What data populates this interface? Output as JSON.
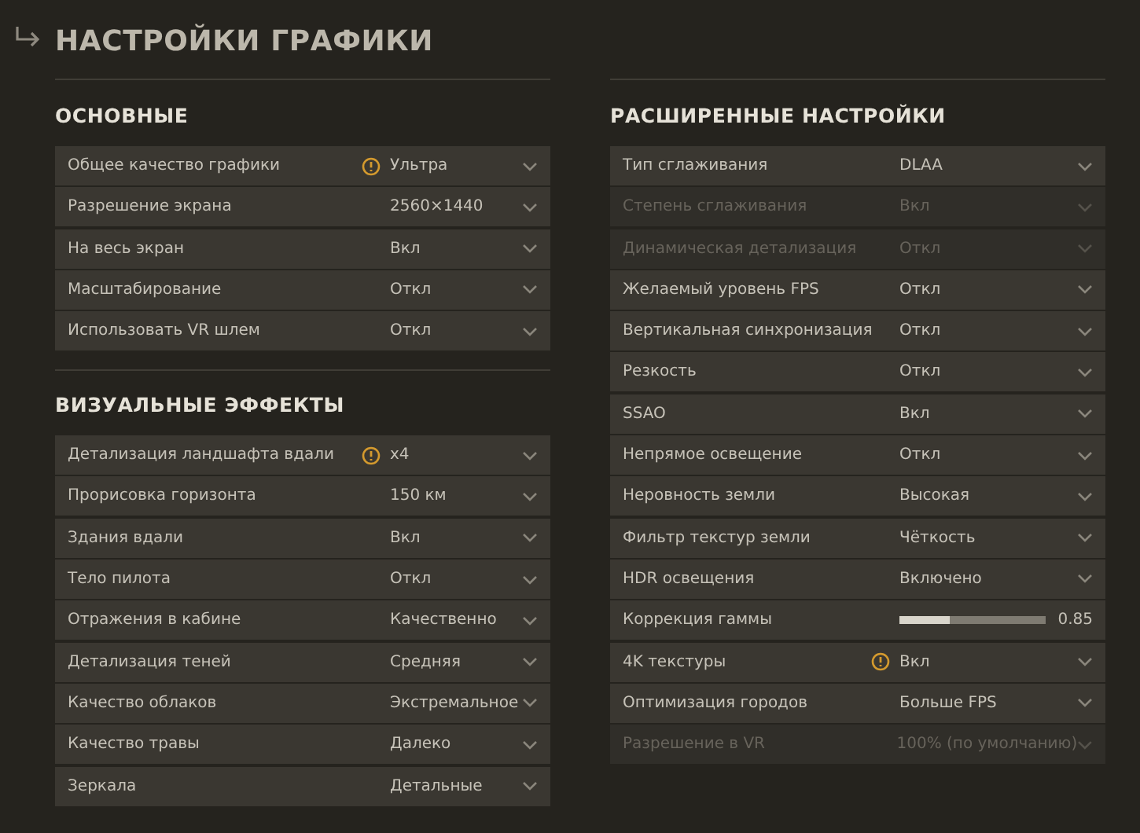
{
  "title": "НАСТРОЙКИ ГРАФИКИ",
  "columns": [
    {
      "sections": [
        {
          "heading": "ОСНОВНЫЕ",
          "rows": [
            {
              "kind": "select",
              "label": "Общее качество графики",
              "value": "Ультра",
              "warning": true,
              "disabled": false
            },
            {
              "kind": "select",
              "label": "Разрешение экрана",
              "value": "2560×1440",
              "warning": false,
              "disabled": false
            },
            {
              "kind": "select",
              "label": "На весь экран",
              "value": "Вкл",
              "warning": false,
              "disabled": false
            },
            {
              "kind": "select",
              "label": "Масштабирование",
              "value": "Откл",
              "warning": false,
              "disabled": false
            },
            {
              "kind": "select",
              "label": "Использовать VR шлем",
              "value": "Откл",
              "warning": false,
              "disabled": false
            }
          ]
        },
        {
          "heading": "ВИЗУАЛЬНЫЕ ЭФФЕКТЫ",
          "rows": [
            {
              "kind": "select",
              "label": "Детализация ландшафта вдали",
              "value": "x4",
              "warning": true,
              "disabled": false
            },
            {
              "kind": "select",
              "label": "Прорисовка горизонта",
              "value": "150 км",
              "warning": false,
              "disabled": false
            },
            {
              "kind": "select",
              "label": "Здания вдали",
              "value": "Вкл",
              "warning": false,
              "disabled": false
            },
            {
              "kind": "select",
              "label": "Тело пилота",
              "value": "Откл",
              "warning": false,
              "disabled": false
            },
            {
              "kind": "select",
              "label": "Отражения в кабине",
              "value": "Качественно",
              "warning": false,
              "disabled": false
            },
            {
              "kind": "select",
              "label": "Детализация теней",
              "value": "Средняя",
              "warning": false,
              "disabled": false
            },
            {
              "kind": "select",
              "label": "Качество облаков",
              "value": "Экстремальное",
              "warning": false,
              "disabled": false
            },
            {
              "kind": "select",
              "label": "Качество травы",
              "value": "Далеко",
              "warning": false,
              "disabled": false
            },
            {
              "kind": "select",
              "label": "Зеркала",
              "value": "Детальные",
              "warning": false,
              "disabled": false
            }
          ]
        }
      ]
    },
    {
      "sections": [
        {
          "heading": "РАСШИРЕННЫЕ НАСТРОЙКИ",
          "rows": [
            {
              "kind": "select",
              "label": "Тип сглаживания",
              "value": "DLAA",
              "warning": false,
              "disabled": false
            },
            {
              "kind": "select",
              "label": "Степень сглаживания",
              "value": "Вкл",
              "warning": false,
              "disabled": true
            },
            {
              "kind": "select",
              "label": "Динамическая детализация",
              "value": "Откл",
              "warning": false,
              "disabled": true
            },
            {
              "kind": "select",
              "label": "Желаемый уровень FPS",
              "value": "Откл",
              "warning": false,
              "disabled": false
            },
            {
              "kind": "select",
              "label": "Вертикальная синхронизация",
              "value": "Откл",
              "warning": false,
              "disabled": false
            },
            {
              "kind": "select",
              "label": "Резкость",
              "value": "Откл",
              "warning": false,
              "disabled": false
            },
            {
              "kind": "select",
              "label": "SSAO",
              "value": "Вкл",
              "warning": false,
              "disabled": false
            },
            {
              "kind": "select",
              "label": "Непрямое освещение",
              "value": "Откл",
              "warning": false,
              "disabled": false
            },
            {
              "kind": "select",
              "label": "Неровность земли",
              "value": "Высокая",
              "warning": false,
              "disabled": false
            },
            {
              "kind": "select",
              "label": "Фильтр текстур земли",
              "value": "Чёткость",
              "warning": false,
              "disabled": false
            },
            {
              "kind": "select",
              "label": "HDR освещения",
              "value": "Включено",
              "warning": false,
              "disabled": false
            },
            {
              "kind": "slider",
              "label": "Коррекция гаммы",
              "value": "0.85",
              "level": 0.35,
              "warning": false,
              "disabled": false
            },
            {
              "kind": "select",
              "label": "4K текстуры",
              "value": "Вкл",
              "warning": true,
              "disabled": false
            },
            {
              "kind": "select",
              "label": "Оптимизация городов",
              "value": "Больше FPS",
              "warning": false,
              "disabled": false
            },
            {
              "kind": "select",
              "label": "Разрешение в VR",
              "value": "100% (по умолчанию)",
              "warning": false,
              "disabled": true
            }
          ]
        }
      ]
    }
  ]
}
